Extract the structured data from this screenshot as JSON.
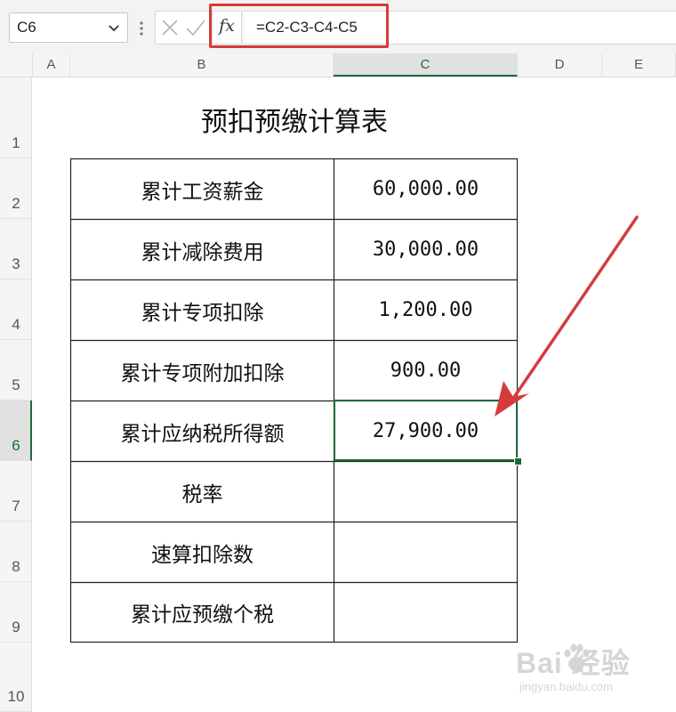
{
  "formula_bar": {
    "name_box": "C6",
    "fx_label": "fx",
    "formula": "=C2-C3-C4-C5"
  },
  "columns": [
    "A",
    "B",
    "C",
    "D",
    "E"
  ],
  "active_column": "C",
  "rows": [
    "1",
    "2",
    "3",
    "4",
    "5",
    "6",
    "7",
    "8",
    "9",
    "10"
  ],
  "active_row": "6",
  "sheet": {
    "title": "预扣预缴计算表",
    "table": [
      {
        "label": "累计工资薪金",
        "value": "60,000.00"
      },
      {
        "label": "累计减除费用",
        "value": "30,000.00"
      },
      {
        "label": "累计专项扣除",
        "value": "1,200.00"
      },
      {
        "label": "累计专项附加扣除",
        "value": "900.00"
      },
      {
        "label": "累计应纳税所得额",
        "value": "27,900.00"
      },
      {
        "label": "税率",
        "value": ""
      },
      {
        "label": "速算扣除数",
        "value": ""
      },
      {
        "label": "累计应预缴个税",
        "value": ""
      }
    ]
  },
  "watermark": {
    "brand": "Bai 经验",
    "url": "jingyan.baidu.com"
  },
  "colors": {
    "accent_green": "#1e6b3a",
    "annotation_red": "#d43c3c"
  }
}
